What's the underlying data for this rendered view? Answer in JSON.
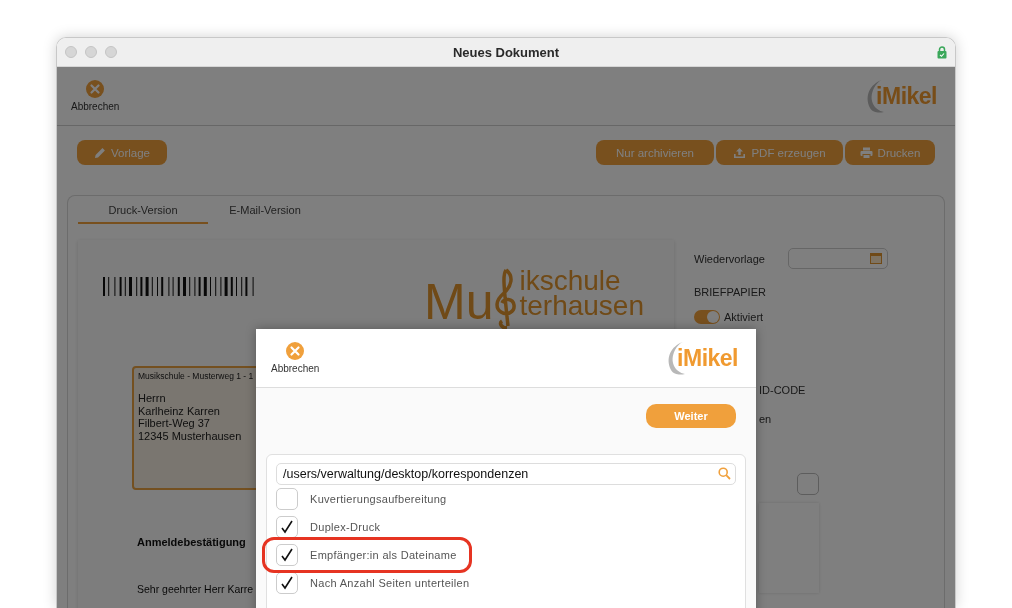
{
  "window": {
    "title": "Neues Dokument"
  },
  "toolbar": {
    "cancel": "Abbrechen",
    "logo": "iMikel"
  },
  "actions": {
    "left": [
      {
        "label": "Vorlage"
      }
    ],
    "right": [
      {
        "label": "Nur archivieren"
      },
      {
        "label": "PDF erzeugen"
      },
      {
        "label": "Drucken"
      }
    ]
  },
  "tabs": [
    {
      "label": "Druck-Version",
      "selected": true
    },
    {
      "label": "E-Mail-Version",
      "selected": false
    }
  ],
  "letter": {
    "logo": [
      "Mu",
      "ikschule",
      "terhausen"
    ],
    "sender_line": "Musikschule - Musterweg 1 - 1",
    "address": [
      "Herrn",
      "Karlheinz Karren",
      "Filbert-Weg 37",
      "12345 Musterhausen"
    ],
    "subject": "Anmeldebestätigung",
    "salutation": "Sehr geehrter Herr Karre"
  },
  "side": {
    "follow_up_label": "Wiedervorlage",
    "letterhead_heading": "BRIEFPAPIER",
    "letterhead_toggle": {
      "label": "Aktiviert",
      "on": true
    },
    "fragment_1": "ID-CODE",
    "fragment_2": "en",
    "checkbox": {
      "checked": false
    }
  },
  "dialog": {
    "cancel": "Abbrechen",
    "logo": "iMikel",
    "next_button": "Weiter",
    "path": "/users/verwaltung/desktop/korrespondenzen",
    "options": [
      {
        "label": "Kuvertierungsaufbereitung",
        "checked": false
      },
      {
        "label": "Duplex-Druck",
        "checked": true
      },
      {
        "label": "Empfänger:in als Dateiname",
        "checked": true
      },
      {
        "label": "Nach Anzahl Seiten unterteilen",
        "checked": true
      }
    ]
  }
}
